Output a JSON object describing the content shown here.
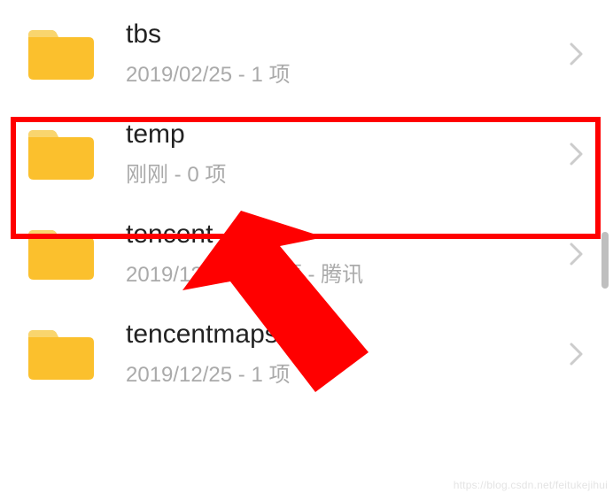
{
  "items": [
    {
      "title": "tbs",
      "subtitle": "2019/02/25 - 1 项"
    },
    {
      "title": "temp",
      "subtitle": "刚刚 - 0 项"
    },
    {
      "title": "tencent",
      "subtitle": "2019/12/25 - 38 项 - 腾讯"
    },
    {
      "title": "tencentmapsdk",
      "subtitle": "2019/12/25 - 1 项"
    }
  ],
  "watermark": "https://blog.csdn.net/feitukejihui",
  "colors": {
    "folder_main": "#FBC02D",
    "folder_tab": "#F9D56E",
    "highlight": "#FF0000",
    "chevron": "#cccccc"
  }
}
